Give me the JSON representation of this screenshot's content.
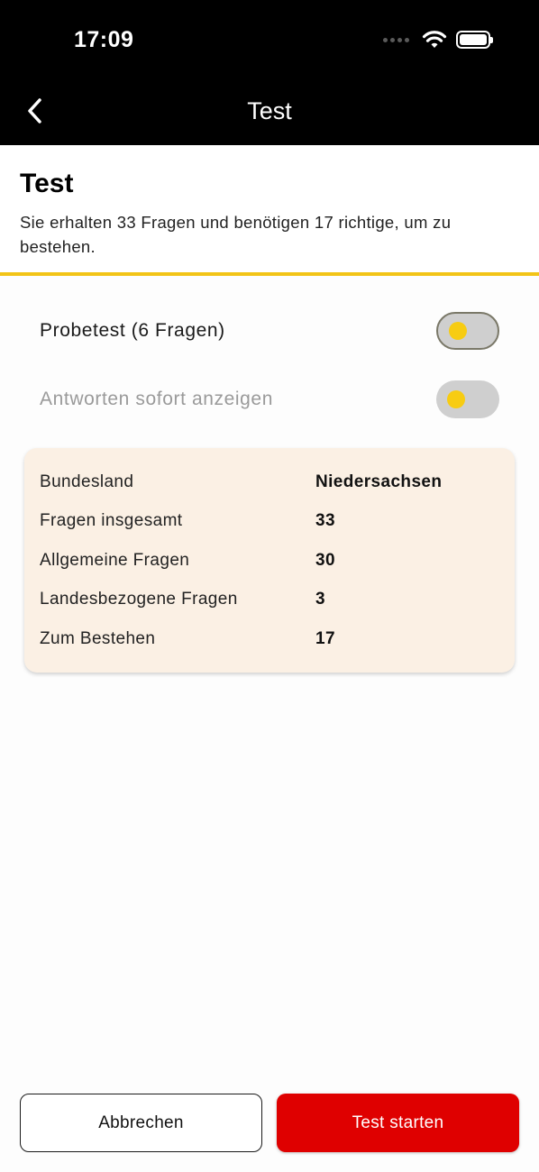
{
  "status_bar": {
    "time": "17:09",
    "icons": [
      "cellular-signal-icon",
      "wifi-icon",
      "battery-icon"
    ]
  },
  "nav": {
    "title": "Test",
    "back_icon": "chevron-left-icon"
  },
  "header": {
    "title": "Test",
    "description": "Sie erhalten 33 Fragen und benötigen 17 richtige, um zu bestehen."
  },
  "options": {
    "probetest_label": "Probetest (6 Fragen)",
    "probetest_on": false,
    "antworten_label": "Antworten sofort anzeigen",
    "antworten_on": false
  },
  "info": {
    "rows": [
      {
        "label": "Bundesland",
        "value": "Niedersachsen"
      },
      {
        "label": "Fragen insgesamt",
        "value": "33"
      },
      {
        "label": "Allgemeine Fragen",
        "value": "30"
      },
      {
        "label": "Landesbezogene Fragen",
        "value": "3"
      },
      {
        "label": "Zum Bestehen",
        "value": "17"
      }
    ]
  },
  "buttons": {
    "cancel_label": "Abbrechen",
    "start_label": "Test starten"
  },
  "colors": {
    "accent_yellow": "#f2c417",
    "primary_red": "#df0000",
    "card_background": "#fbf0e4"
  }
}
